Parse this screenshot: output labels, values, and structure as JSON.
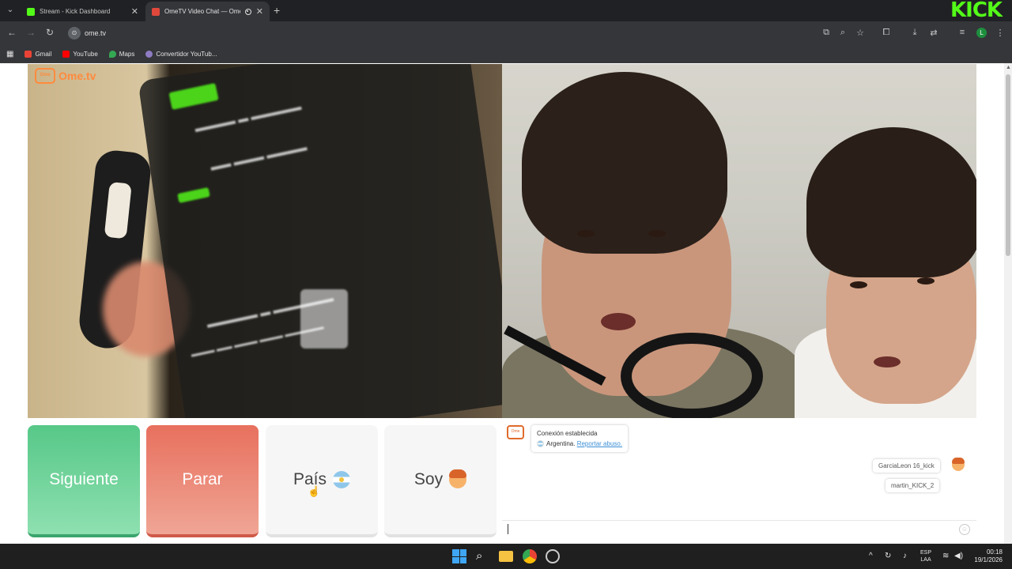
{
  "browser": {
    "tabs": [
      {
        "title": "Stream - Kick Dashboard",
        "active": false
      },
      {
        "title": "OmeTV Video Chat — Ome",
        "active": true
      }
    ],
    "url": "ome.tv",
    "bookmarks": [
      {
        "label": "Gmail",
        "icon": "gmail-icon"
      },
      {
        "label": "YouTube",
        "icon": "youtube-icon"
      },
      {
        "label": "Maps",
        "icon": "maps-icon"
      },
      {
        "label": "Convertidor YouTub...",
        "icon": "converter-icon"
      }
    ],
    "profile_initial": "L",
    "overlay_logo": "KICK"
  },
  "ome": {
    "logo_text": "Ome.tv",
    "buttons": {
      "next": "Siguiente",
      "stop": "Parar",
      "country": "País",
      "gender": "Soy"
    },
    "chat": {
      "system_line1": "Conexión establecida",
      "system_country": "Argentina.",
      "report_link": "Reportar abuso.",
      "messages": [
        {
          "text": "GarciaLeon 16_kick"
        },
        {
          "text": "martin_KICK_2"
        }
      ]
    }
  },
  "taskbar": {
    "lang_line1": "ESP",
    "lang_line2": "LAA",
    "time": "00:18",
    "date": "19/1/2026"
  },
  "colors": {
    "next": "#57c888",
    "stop": "#e8705e",
    "kick_green": "#53fc18",
    "ome_orange": "#ff8a3d"
  }
}
